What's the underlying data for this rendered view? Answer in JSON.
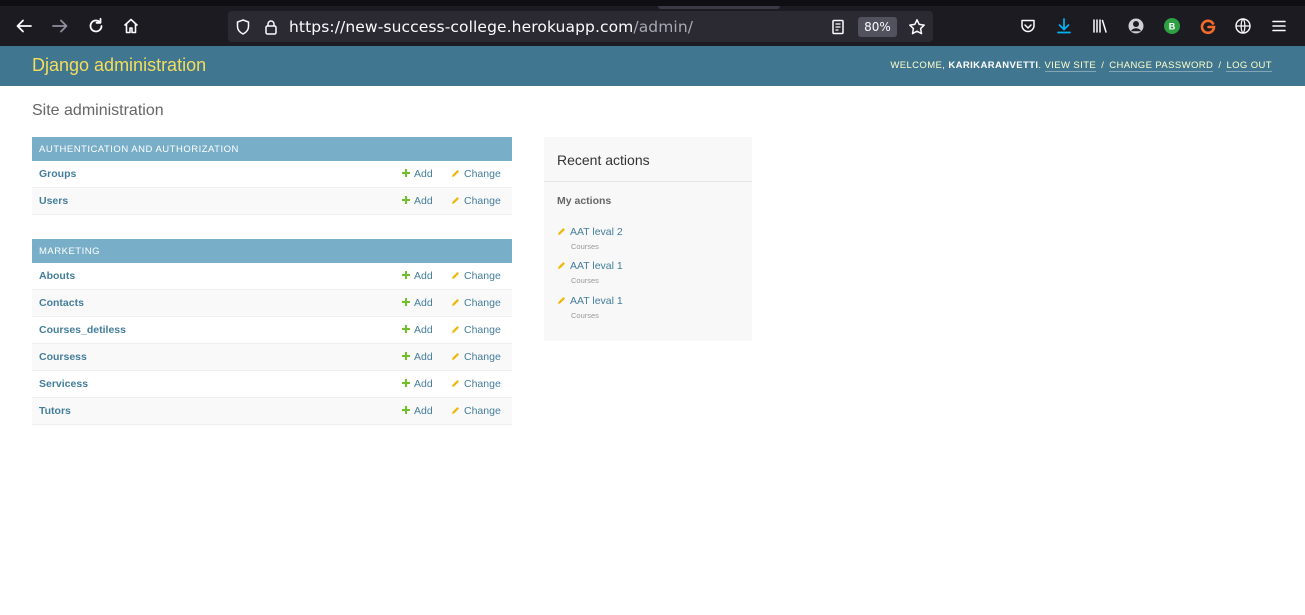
{
  "browser": {
    "url_host": "https://new-success-college.herokuapp.com",
    "url_path": "/admin/",
    "zoom": "80%",
    "profile_badge": "B"
  },
  "header": {
    "branding": "Django administration",
    "welcome": "WELCOME,",
    "username": "KARIKARANVETTI",
    "view_site": "VIEW SITE",
    "change_password": "CHANGE PASSWORD",
    "log_out": "LOG OUT",
    "separator": "/"
  },
  "page_title": "Site administration",
  "modules": [
    {
      "caption": "Authentication and Authorization",
      "rows": [
        {
          "name": "Groups",
          "add": "Add",
          "change": "Change"
        },
        {
          "name": "Users",
          "add": "Add",
          "change": "Change"
        }
      ]
    },
    {
      "caption": "Marketing",
      "rows": [
        {
          "name": "Abouts",
          "add": "Add",
          "change": "Change"
        },
        {
          "name": "Contacts",
          "add": "Add",
          "change": "Change"
        },
        {
          "name": "Courses_detiless",
          "add": "Add",
          "change": "Change"
        },
        {
          "name": "Coursess",
          "add": "Add",
          "change": "Change"
        },
        {
          "name": "Servicess",
          "add": "Add",
          "change": "Change"
        },
        {
          "name": "Tutors",
          "add": "Add",
          "change": "Change"
        }
      ]
    }
  ],
  "recent_actions": {
    "title": "Recent actions",
    "subtitle": "My actions",
    "items": [
      {
        "label": "AAT leval 2",
        "type": "Courses"
      },
      {
        "label": "AAT leval 1",
        "type": "Courses"
      },
      {
        "label": "AAT leval 1",
        "type": "Courses"
      }
    ]
  },
  "colors": {
    "header_bg": "#417690",
    "branding": "#f5dd5d",
    "caption_bg": "#79aec8",
    "link": "#447e9b",
    "add_icon": "#70bf2b",
    "change_icon": "#efb80b"
  }
}
